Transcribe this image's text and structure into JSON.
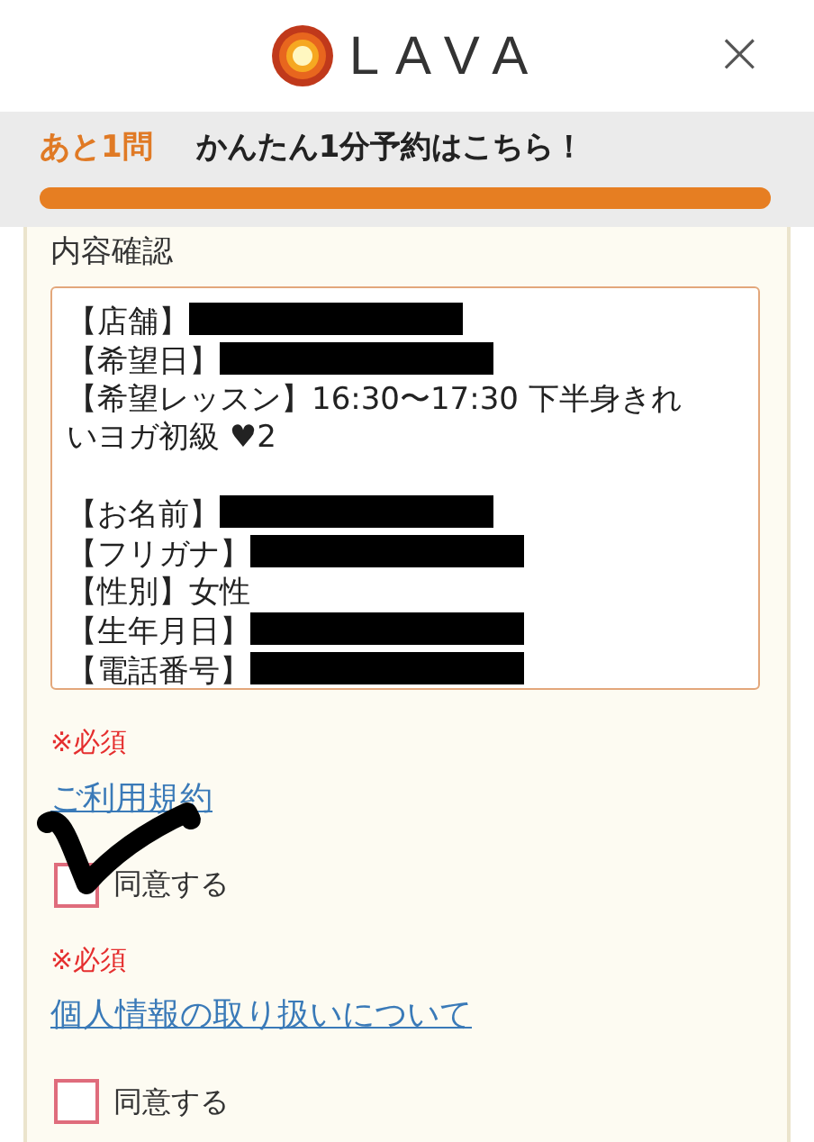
{
  "header": {
    "logo_text": "LAVA",
    "close": "×"
  },
  "progress": {
    "remaining": "あと1問",
    "message": "かんたん1分予約はこちら！",
    "level": 1
  },
  "confirm": {
    "title": "内容確認",
    "lines": [
      {
        "kind": "redacted",
        "label": "【店舗】"
      },
      {
        "kind": "redacted",
        "label": "【希望日】"
      },
      {
        "kind": "text",
        "label": "【希望レッスン】",
        "value": "16:30〜17:30 下半身きれいヨガ初級 ♥2"
      },
      {
        "kind": "blank"
      },
      {
        "kind": "redacted",
        "label": "【お名前】"
      },
      {
        "kind": "redacted",
        "label": "【フリガナ】"
      },
      {
        "kind": "text",
        "label": "【性別】",
        "value": "女性"
      },
      {
        "kind": "redacted",
        "label": "【生年月日】"
      },
      {
        "kind": "redacted",
        "label": "【電話番号】"
      }
    ]
  },
  "consents": [
    {
      "required": "※必須",
      "link": "ご利用規約",
      "label": "同意する",
      "checked": true
    },
    {
      "required": "※必須",
      "link": "個人情報の取り扱いについて",
      "label": "同意する",
      "checked": false
    }
  ]
}
